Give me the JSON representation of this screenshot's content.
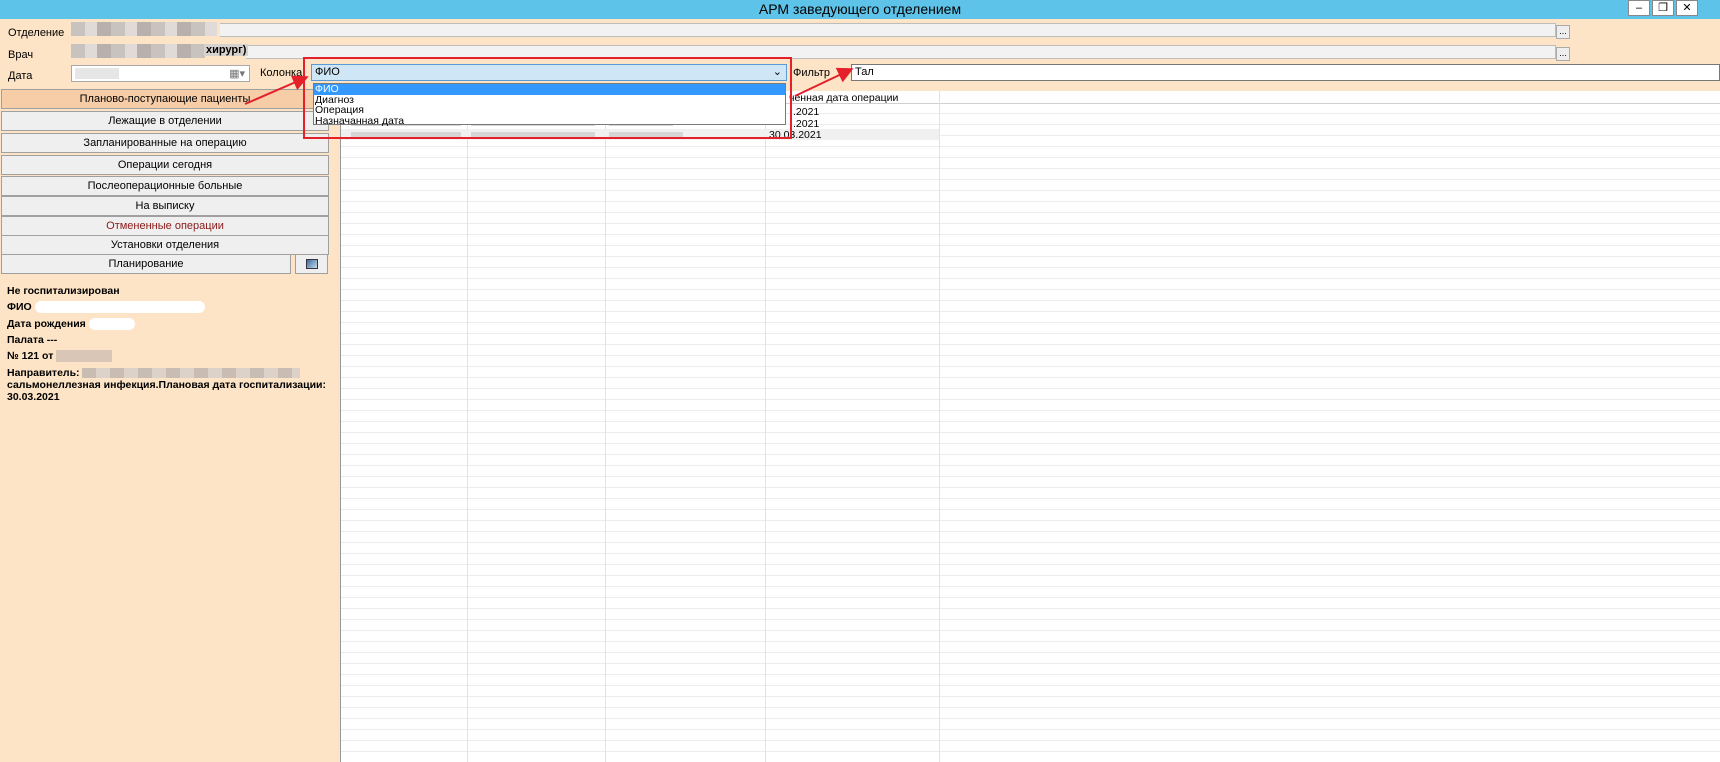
{
  "window": {
    "title": "АРМ заведующего отделением",
    "min": "‒",
    "restore": "❐",
    "close": "✕"
  },
  "header": {
    "department_label": "Отделение",
    "doctor_label": "Врач",
    "doctor_suffix": "хирург)",
    "date_label": "Дата",
    "column_label": "Колонка",
    "column_value": "ФИО",
    "filter_label": "Фильтр",
    "filter_value": "Тал",
    "ellipsis": "..."
  },
  "column_dropdown": {
    "options": [
      "ФИО",
      "Диагноз",
      "Операция",
      "Назначанная дата"
    ],
    "selected": "ФИО"
  },
  "nav": {
    "items": [
      {
        "label": "Планово-поступающие пациенты",
        "active": true
      },
      {
        "label": "Лежащие в отделении"
      },
      {
        "label": "Запланированные на операцию"
      },
      {
        "label": "Операции сегодня"
      },
      {
        "label": "Послеоперационные больные"
      },
      {
        "label": "На выписку"
      },
      {
        "label": "Отмененные операции",
        "highlight": true
      },
      {
        "label": "Установки отделения"
      },
      {
        "label": "Планирование"
      }
    ]
  },
  "patient_info": {
    "status": "Не госпитализирован",
    "fio_label": "ФИО",
    "birth_label": "Дата рождения",
    "ward": "Палата ---",
    "number": "№ 121 от",
    "referral_label": "Направитель:",
    "diagnosis_line": "сальмонеллезная инфекция.Плановая дата госпитализации:",
    "planned_date": "30.03.2021"
  },
  "grid": {
    "header_visible": "ченная дата операции",
    "rows": [
      {
        "date": ".2021"
      },
      {
        "date": ".2021"
      },
      {
        "date": "30.03.2021"
      }
    ]
  },
  "colors": {
    "accent_red": "#e4202b",
    "titlebar": "#5ec3e8",
    "panel_bg": "#fde4c6"
  }
}
